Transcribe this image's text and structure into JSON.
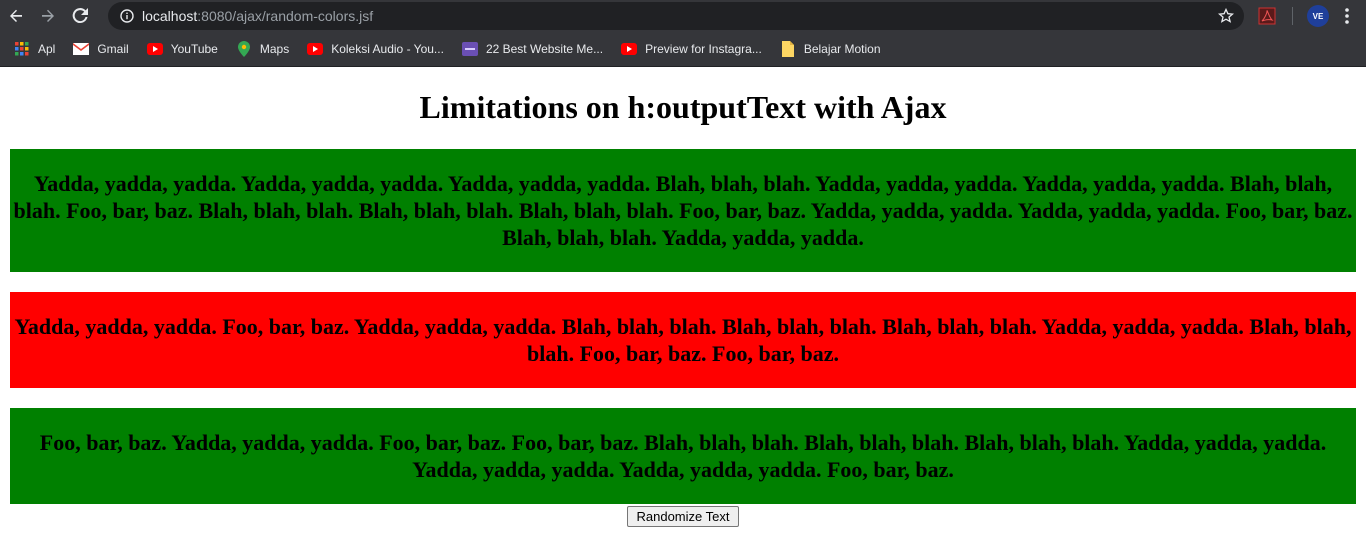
{
  "browser": {
    "url_host": "localhost",
    "url_rest": ":8080/ajax/random-colors.jsf",
    "avatar_text": "VE",
    "bookmarks": [
      {
        "label": "Apl",
        "icon": "apps-grid-icon"
      },
      {
        "label": "Gmail",
        "icon": "gmail-icon"
      },
      {
        "label": "YouTube",
        "icon": "youtube-icon"
      },
      {
        "label": "Maps",
        "icon": "maps-icon"
      },
      {
        "label": "Koleksi Audio - You...",
        "icon": "youtube-icon"
      },
      {
        "label": "22 Best Website Me...",
        "icon": "site-favicon-icon"
      },
      {
        "label": "Preview for Instagra...",
        "icon": "youtube-icon"
      },
      {
        "label": "Belajar Motion",
        "icon": "bookmark-page-icon"
      }
    ]
  },
  "page": {
    "title": "Limitations on h:outputText with Ajax",
    "blocks": [
      {
        "text": "Yadda, yadda, yadda. Yadda, yadda, yadda. Yadda, yadda, yadda. Blah, blah, blah. Yadda, yadda, yadda. Yadda, yadda, yadda. Blah, blah, blah. Foo, bar, baz. Blah, blah, blah. Blah, blah, blah. Blah, blah, blah. Foo, bar, baz. Yadda, yadda, yadda. Yadda, yadda, yadda. Foo, bar, baz. Blah, blah, blah. Yadda, yadda, yadda.",
        "color": "#008000"
      },
      {
        "text": "Yadda, yadda, yadda. Foo, bar, baz. Yadda, yadda, yadda. Blah, blah, blah. Blah, blah, blah. Blah, blah, blah. Yadda, yadda, yadda. Blah, blah, blah. Foo, bar, baz. Foo, bar, baz.",
        "color": "#ff0000"
      },
      {
        "text": "Foo, bar, baz. Yadda, yadda, yadda. Foo, bar, baz. Foo, bar, baz. Blah, blah, blah. Blah, blah, blah. Blah, blah, blah. Yadda, yadda, yadda. Yadda, yadda, yadda. Yadda, yadda, yadda. Foo, bar, baz.",
        "color": "#008000"
      }
    ],
    "button_label": "Randomize Text"
  }
}
